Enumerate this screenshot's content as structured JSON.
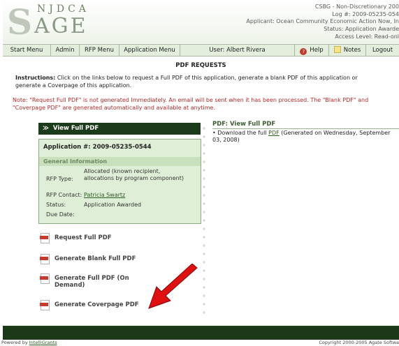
{
  "logo": {
    "nj": "NJDCA",
    "s": "S",
    "age": "AGE"
  },
  "header": {
    "line1": "CSBG - Non-Discretionary 200",
    "line2": "Log #: 2009-05235-054",
    "applicant": "Applicant: Ocean Community Economic Action Now, In",
    "line4": "Status: Application Awarde",
    "line5": "Access Level: Read-onl"
  },
  "menu": {
    "start": "Start Menu",
    "admin": "Admin",
    "rfp": "RFP Menu",
    "application": "Application Menu",
    "user": "User: Albert Rivera",
    "help": "Help",
    "notes": "Notes",
    "logout": "Logout"
  },
  "page_title": "PDF REQUESTS",
  "instructions": {
    "bold": "Instructions:",
    "text": " Click on the links below to request a Full PDF of this application, generate a blank PDF of this application or generate a Coverpage of this application."
  },
  "note": "Note: \"Request Full PDF\" is not generated Immediately. An email will be sent when it has been processed. The \"Blank PDF\" and \"Coverpage PDF\" are generated automatically and available at anytime.",
  "left": {
    "view_full": "View Full PDF",
    "app_number": "Application #: 2009-05235-0544",
    "general_info": "General Information",
    "rfp_type_label": "RFP Type:",
    "rfp_type_value": "Allocated (known recipient, allocations by program component)",
    "rfp_contact_label": "RFP Contact:",
    "rfp_contact_value": "Patricia Swartz",
    "status_label": "Status:",
    "status_value": "Application Awarded",
    "due_label": "Due Date:",
    "due_value": ""
  },
  "actions": {
    "request_full": "Request Full PDF",
    "blank_full": "Generate Blank Full PDF",
    "on_demand_1": "Generate Full PDF (On",
    "on_demand_2": "Demand)",
    "coverpage": "Generate Coverpage PDF"
  },
  "right": {
    "title": "PDF: View Full PDF",
    "bullet": "•",
    "pre": " Download the full ",
    "link": "PDF",
    "post": " (Generated on Wednesday, September 03, 2008)"
  },
  "footer": {
    "powered_pre": "Powered by ",
    "powered_link": "IntelliGrants",
    "copyright": "Copyright 2000-2005 Agate Softwa"
  },
  "colors": {
    "dark_green": "#1c3818",
    "panel_green": "#dfeed7",
    "note_red": "#b12a2a",
    "annotation_arrow": "#e01010"
  }
}
